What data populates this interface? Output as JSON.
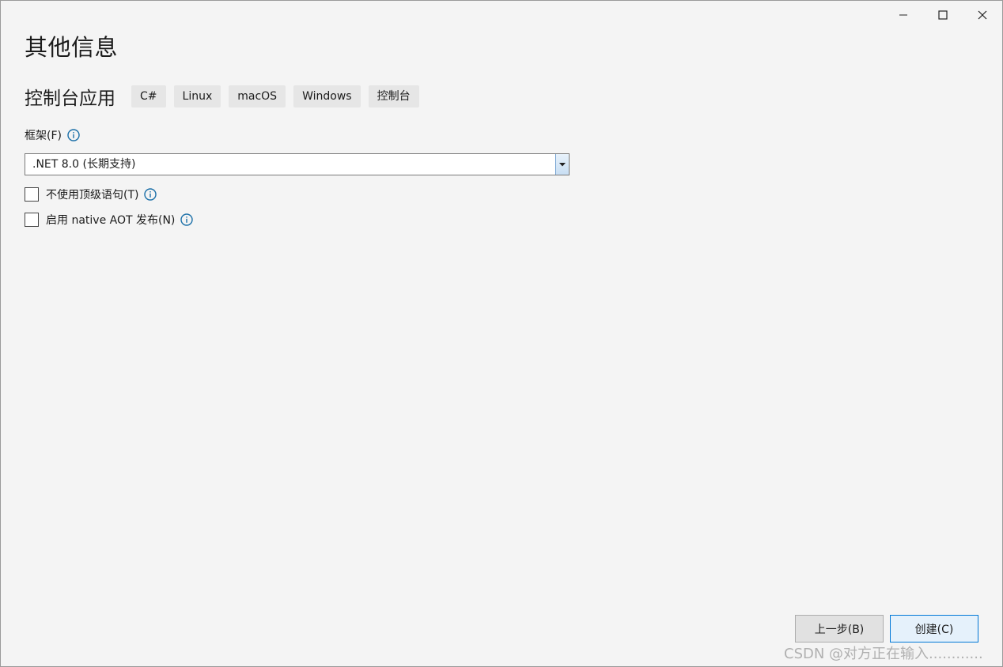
{
  "window": {
    "controls": {
      "minimize_icon": "minimize-icon",
      "maximize_icon": "maximize-icon",
      "close_icon": "close-icon"
    }
  },
  "page": {
    "title": "其他信息",
    "app_name": "控制台应用",
    "tags": [
      "C#",
      "Linux",
      "macOS",
      "Windows",
      "控制台"
    ]
  },
  "framework": {
    "label": "框架(F)",
    "selected": ".NET 8.0 (长期支持)"
  },
  "options": {
    "top_level_statements": "不使用顶级语句(T)",
    "native_aot": "启用 native AOT 发布(N)"
  },
  "buttons": {
    "back": "上一步(B)",
    "create": "创建(C)"
  },
  "watermark": "CSDN @对方正在输入............",
  "colors": {
    "info_icon": "#1a6fa8",
    "accent_border": "#0078d7"
  }
}
